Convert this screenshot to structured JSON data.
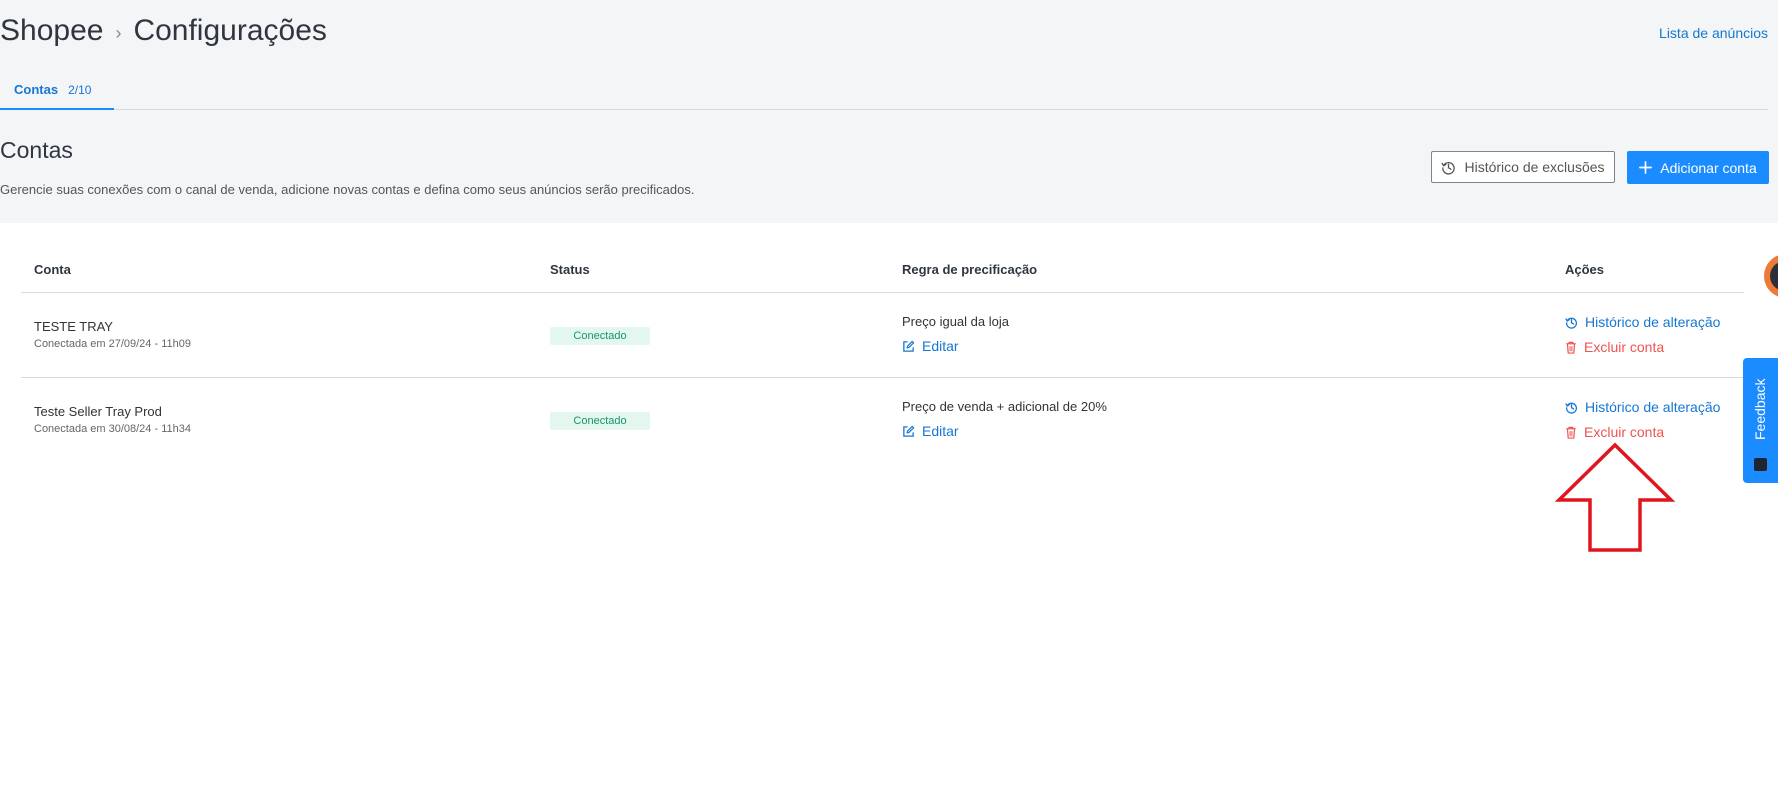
{
  "breadcrumb": {
    "root": "Shopee",
    "separator": "›",
    "current": "Configurações"
  },
  "top_link": "Lista de anúncios",
  "tabs": [
    {
      "label": "Contas",
      "count": "2/10",
      "active": true
    }
  ],
  "section": {
    "title": "Contas",
    "description": "Gerencie suas conexões com o canal de venda, adicione novas contas e defina como seus anúncios serão precificados."
  },
  "buttons": {
    "history": "Histórico de exclusões",
    "add": "Adicionar conta"
  },
  "table": {
    "headers": {
      "account": "Conta",
      "status": "Status",
      "rule": "Regra de precificação",
      "actions": "Ações"
    },
    "rows": [
      {
        "name": "TESTE TRAY",
        "connected": "Conectada em 27/09/24 - 11h09",
        "status": "Conectado",
        "rule": "Preço igual da loja",
        "edit": "Editar",
        "history": "Histórico de alteração",
        "delete": "Excluir conta"
      },
      {
        "name": "Teste Seller Tray Prod",
        "connected": "Conectada em 30/08/24 - 11h34",
        "status": "Conectado",
        "rule": "Preço de venda + adicional de 20%",
        "edit": "Editar",
        "history": "Histórico de alteração",
        "delete": "Excluir conta"
      }
    ]
  },
  "feedback": {
    "label": "Feedback"
  },
  "colors": {
    "accent": "#1a8cff",
    "link": "#1677d2",
    "danger": "#ef5350",
    "success_bg": "#e3f7ef",
    "success_text": "#17966b",
    "annotation_arrow": "#e0161e"
  },
  "icons": {
    "history": "history-clock-icon",
    "add": "plus-icon",
    "edit": "edit-icon",
    "delete": "trash-icon",
    "feedback": "feedback-icon"
  }
}
